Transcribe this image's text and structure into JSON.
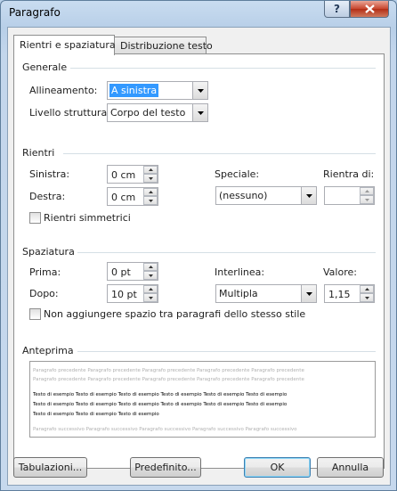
{
  "window": {
    "title": "Paragrafo",
    "help_label": "?"
  },
  "tabs": [
    {
      "label": "Rientri e spaziatura",
      "active": true
    },
    {
      "label": "Distribuzione testo",
      "active": false
    }
  ],
  "generale": {
    "title": "Generale",
    "allineamento_label": "Allineamento:",
    "allineamento_value": "A sinistra",
    "livello_label": "Livello struttura:",
    "livello_value": "Corpo del testo"
  },
  "rientri": {
    "title": "Rientri",
    "sinistra_label": "Sinistra:",
    "sinistra_value": "0 cm",
    "destra_label": "Destra:",
    "destra_value": "0 cm",
    "speciale_label": "Speciale:",
    "speciale_value": "(nessuno)",
    "rientra_di_label": "Rientra di:",
    "rientra_di_value": "",
    "simmetrici_label": "Rientri simmetrici",
    "simmetrici_checked": false
  },
  "spaziatura": {
    "title": "Spaziatura",
    "prima_label": "Prima:",
    "prima_value": "0 pt",
    "dopo_label": "Dopo:",
    "dopo_value": "10 pt",
    "interlinea_label": "Interlinea:",
    "interlinea_value": "Multipla",
    "valore_label": "Valore:",
    "valore_value": "1,15",
    "no_space_label": "Non aggiungere spazio tra paragrafi dello stesso stile",
    "no_space_checked": false
  },
  "anteprima": {
    "title": "Anteprima",
    "lines_prev": [
      "Paragrafo precedente Paragrafo precedente Paragrafo precedente Paragrafo precedente Paragrafo precedente",
      "Paragrafo precedente Paragrafo precedente Paragrafo precedente Paragrafo precedente Paragrafo precedente"
    ],
    "lines_sample": [
      "Testo di esempio Testo di esempio Testo di esempio Testo di esempio Testo di esempio Testo di esempio",
      "Testo di esempio Testo di esempio Testo di esempio Testo di esempio Testo di esempio Testo di esempio",
      "Testo di esempio Testo di esempio Testo di esempio"
    ],
    "lines_next": [
      "Paragrafo successivo Paragrafo successivo Paragrafo successivo Paragrafo successivo Paragrafo successivo"
    ]
  },
  "buttons": {
    "tabulazioni": "Tabulazioni...",
    "predefinito": "Predefinito...",
    "ok": "OK",
    "annulla": "Annulla"
  },
  "colors": {
    "selection": "#3399ff",
    "close_button": "#c7452d",
    "titlebar": "#b9d1ea"
  }
}
